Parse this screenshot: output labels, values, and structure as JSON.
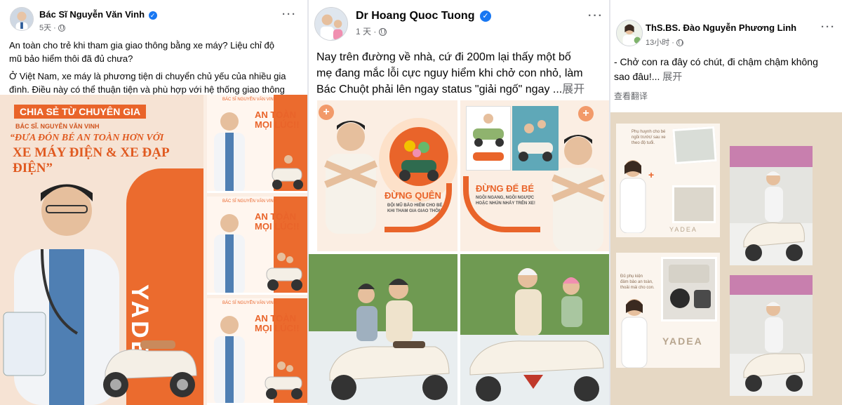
{
  "post1": {
    "author": "Bác Sĩ Nguyễn Văn Vinh",
    "time": "5天",
    "text_line1": "An toàn cho trẻ khi tham gia giao thông bằng xe máy? Liệu chỉ độ",
    "text_line2": "mũ bảo hiểm thôi đã đủ chưa?",
    "text_line3": "Ở Việt Nam, xe máy là phương tiện di chuyển chủ yếu của nhiều gia",
    "text_line4": "đình. Điều này có thể thuận tiện và phù hợp với hệ thống giao thông",
    "poster": {
      "tag": "CHIA SẺ TỪ CHUYÊN GIA",
      "doctor": "BÁC SĨ. NGUYỄN VĂN VINH",
      "headline1": "“ĐƯA ĐÓN BÉ AN TOÀN HƠN VỚI",
      "headline2": "XE MÁY ĐIỆN & XE ĐẠP ĐIỆN”",
      "brand": "YADEA",
      "side_title1": "AN TOÀN",
      "side_title2": "MỌI LÚC!!",
      "side_title3": "AN TOÀN",
      "side_title4": "MỌI LÚC!!",
      "side_title5": "AN TOÀN",
      "side_title6": "MỌI LÚC!!",
      "side_doctor": "BÁC SĨ NGUYỄN VĂN VINH"
    }
  },
  "post2": {
    "author": "Dr Hoang Quoc Tuong",
    "time": "1 天",
    "text_line1": "Nay trên đường về nhà, cứ đi 200m lại thấy một bố",
    "text_line2": "mẹ đang mắc lỗi cực nguy hiểm khi chở con nhỏ, làm",
    "text_line3": "Bác Chuột phải lên ngay status \"giải ngố\" ngay ...",
    "see_more": "展开",
    "img1_title": "ĐỪNG QUÊN",
    "img1_sub1": "ĐỘI MŨ BẢO HIỂM CHO BÉ",
    "img1_sub2": "KHI THAM GIA GIAO THÔNG!",
    "img2_title": "ĐỪNG ĐỂ BÉ",
    "img2_sub1": "NGỒI NGANG, NGỒI NGƯỢC",
    "img2_sub2": "HOẶC NHÚN NHẢY TRÊN XE!"
  },
  "post3": {
    "author": "ThS.BS. Đào Nguyễn Phương Linh",
    "time": "13小时",
    "text_line1": "- Chở con ra đây có chút, đi chậm chậm không",
    "text_line2": "sao đâu!...",
    "see_more": "展开",
    "translate": "查看翻译",
    "card1_text1": "Phụ huynh cho bé",
    "card1_text2": "ngồi trước/ sau xe",
    "card1_text3": "theo độ tuổi.",
    "card2_text1": "Đủ phụ kiện",
    "card2_text2": "đảm bảo an toàn,",
    "card2_text3": "thoải mái cho con.",
    "brand": "YADEA"
  },
  "colors": {
    "accent_orange": "#e9642a",
    "fb_blue": "#1877f2",
    "meta_gray": "#65676b"
  }
}
